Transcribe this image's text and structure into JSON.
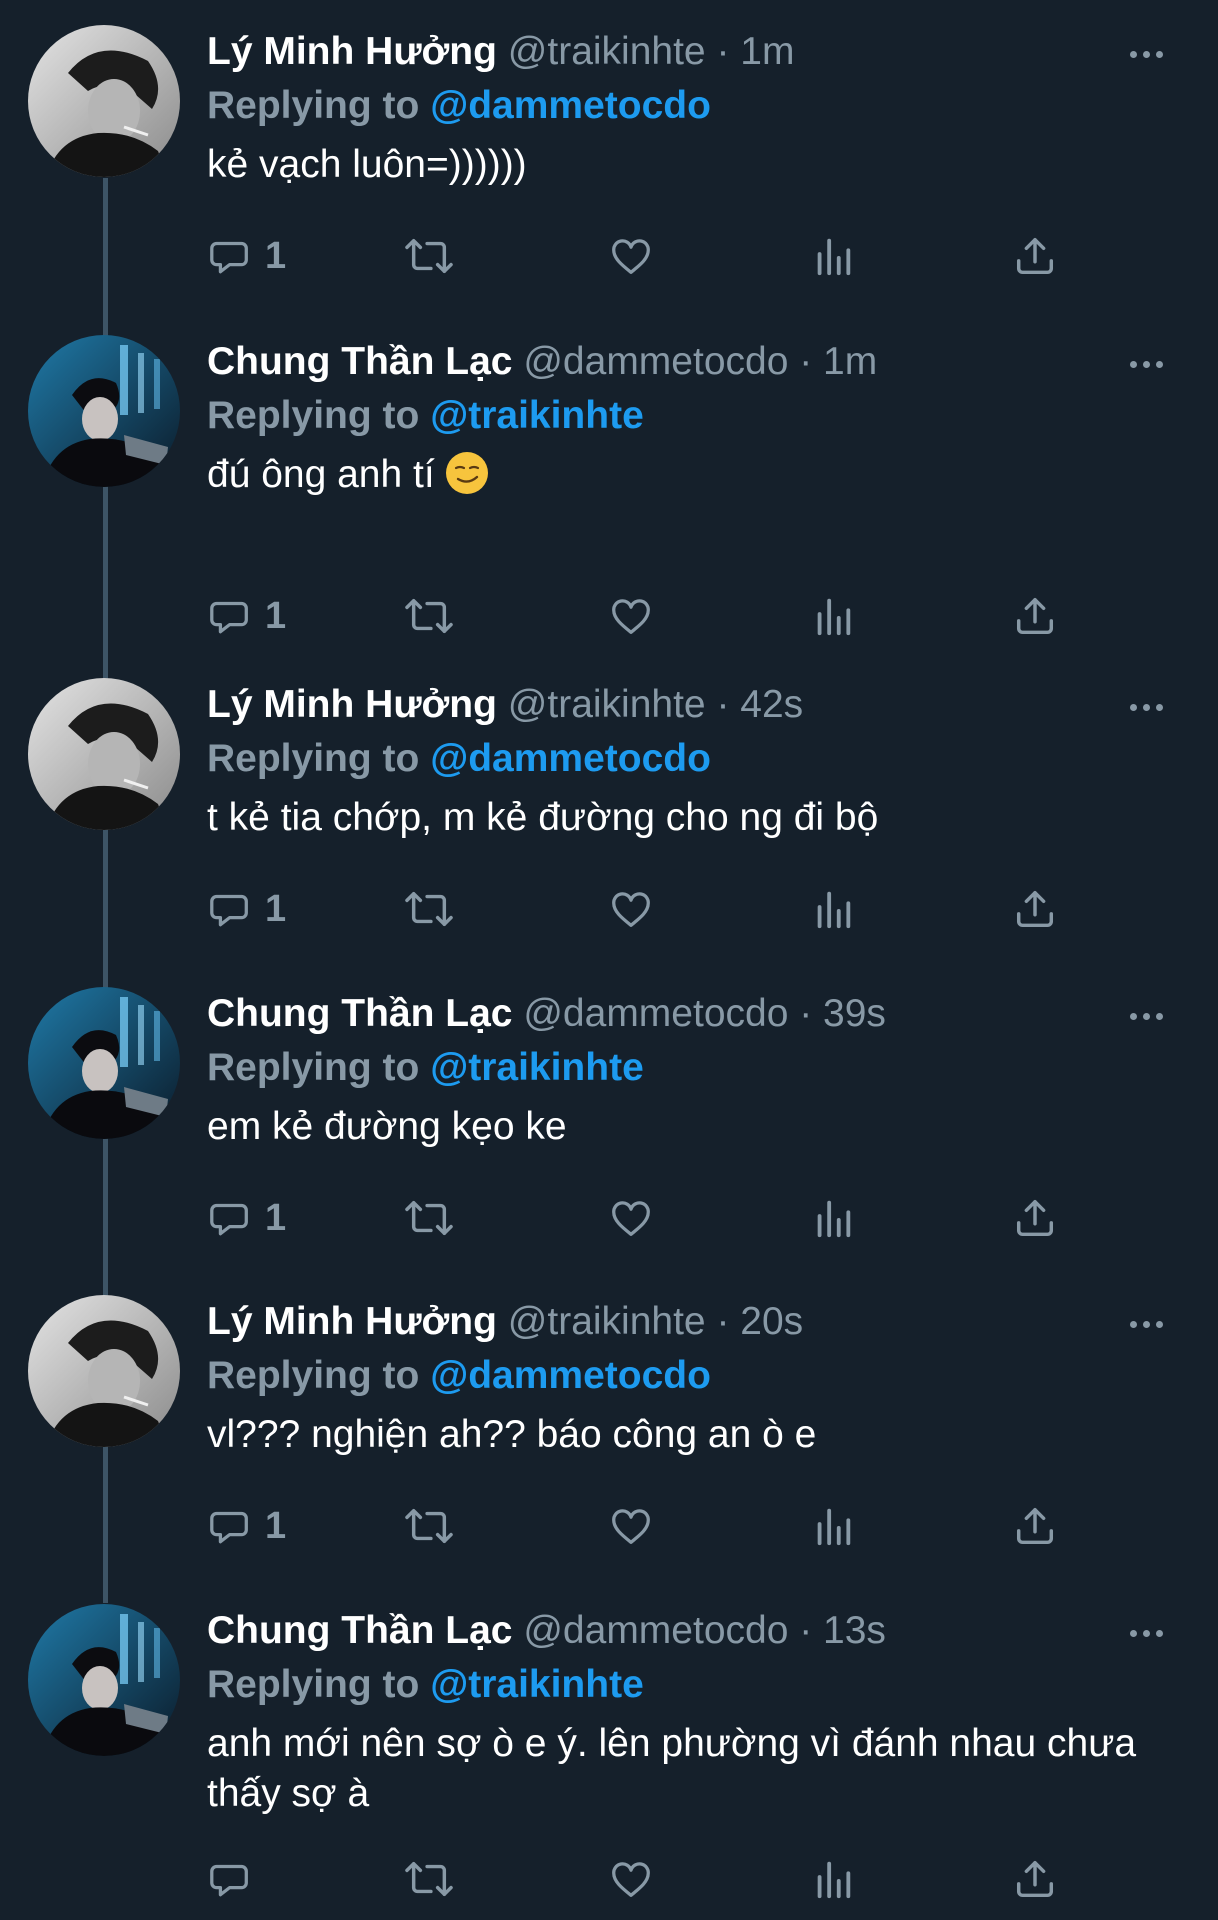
{
  "reply_prefix": "Replying to",
  "tweets": [
    {
      "name": "Lý Minh Hưởng",
      "meta": "@traikinhte · 1m",
      "reply_to": "@dammetocdo",
      "text": "kẻ vạch luôn=))))))",
      "replies": "1",
      "avatar": "mono-portrait"
    },
    {
      "name": "Chung Thần Lạc",
      "meta": "@dammetocdo · 1m",
      "reply_to": "@traikinhte",
      "text": "đú ông anh tí",
      "emoji": "smirking-face-emoji",
      "replies": "1",
      "avatar": "blue-neon-portrait"
    },
    {
      "name": "Lý Minh Hưởng",
      "meta": "@traikinhte · 42s",
      "reply_to": "@dammetocdo",
      "text": "t kẻ tia chớp, m kẻ đường cho ng đi bộ",
      "replies": "1",
      "avatar": "mono-portrait"
    },
    {
      "name": "Chung Thần Lạc",
      "meta": "@dammetocdo · 39s",
      "reply_to": "@traikinhte",
      "text": "em kẻ đường kẹo ke",
      "replies": "1",
      "avatar": "blue-neon-portrait"
    },
    {
      "name": "Lý Minh Hưởng",
      "meta": "@traikinhte · 20s",
      "reply_to": "@dammetocdo",
      "text": "vl??? nghiện ah?? báo công an ò e",
      "replies": "1",
      "avatar": "mono-portrait"
    },
    {
      "name": "Chung Thần Lạc",
      "meta": "@dammetocdo · 13s",
      "reply_to": "@traikinhte",
      "text": "anh mới nên sợ ò e ý. lên phường vì đánh nhau chưa thấy sợ à",
      "replies": "",
      "avatar": "blue-neon-portrait"
    }
  ],
  "colors": {
    "background": "#15202b",
    "link": "#1d9bf0",
    "secondary": "#8899a6",
    "thread_line": "#3d5466"
  },
  "icons": [
    "reply-icon",
    "retweet-icon",
    "like-icon",
    "analytics-icon",
    "share-icon",
    "more-icon"
  ]
}
